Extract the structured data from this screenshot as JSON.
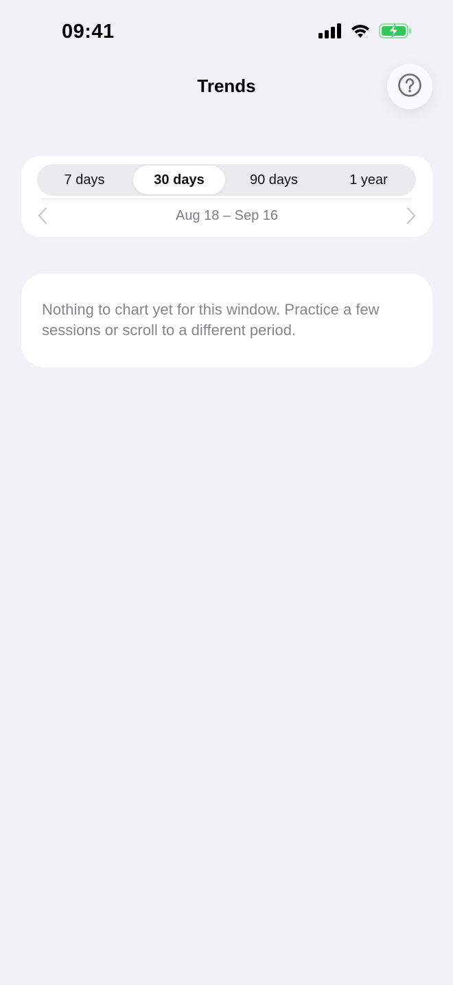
{
  "status_bar": {
    "time": "09:41",
    "icons": [
      "cellular-signal-icon",
      "wifi-icon",
      "battery-charging-icon"
    ],
    "battery_color": "#34c759"
  },
  "nav": {
    "title": "Trends",
    "help_icon": "question-circle-icon"
  },
  "range_picker": {
    "options": [
      {
        "label": "7 days",
        "selected": false
      },
      {
        "label": "30 days",
        "selected": true
      },
      {
        "label": "90 days",
        "selected": false
      },
      {
        "label": "1 year",
        "selected": false
      }
    ],
    "date_range": "Aug 18 – Sep 16",
    "prev_icon": "chevron-left-icon",
    "next_icon": "chevron-right-icon"
  },
  "empty_state": {
    "message": "Nothing to chart yet for this window. Practice a few sessions or scroll to a different period."
  },
  "colors": {
    "background": "#f2f1f6",
    "card": "#ffffff",
    "secondary_text": "#7c7c82"
  }
}
